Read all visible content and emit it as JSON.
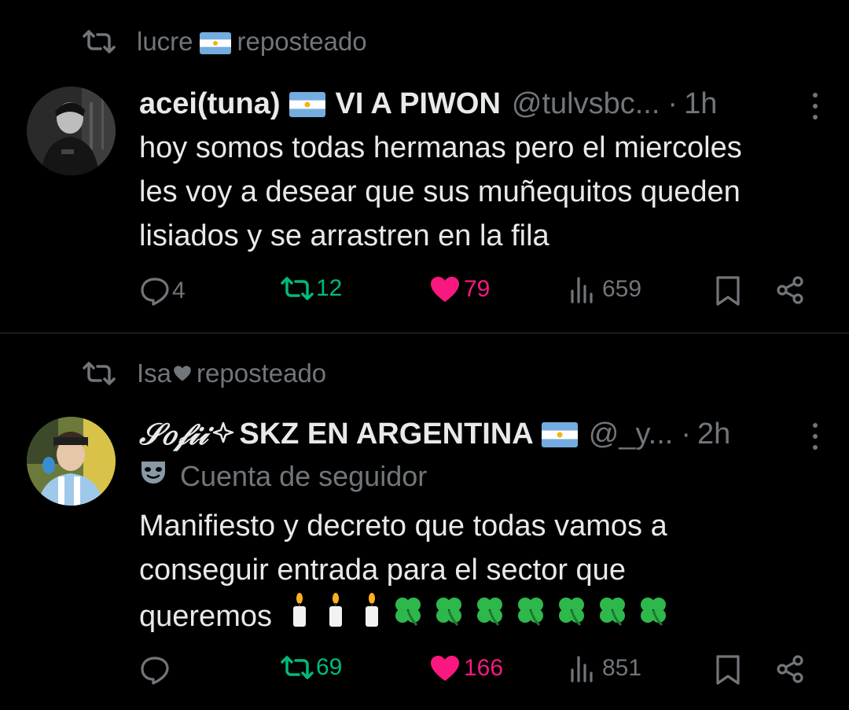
{
  "tweets": [
    {
      "repost_by": "lucre",
      "repost_label": "reposteado",
      "display_name": "acei(tuna)",
      "display_name_suffix": "VI A PIWON",
      "handle": "@tulvsbc...",
      "dot": "·",
      "time": "1h",
      "text_lines": [
        "hoy somos todas hermanas pero el miercoles",
        "les voy a desear que sus muñequitos queden",
        "lisiados y se arrastren en la fila"
      ],
      "stats": {
        "replies": "4",
        "reposts": "12",
        "likes": "79",
        "views": "659"
      }
    },
    {
      "repost_by": "Isa",
      "repost_label": "reposteado",
      "display_name": "𝒮𝑜𝒻𝒾𝒾",
      "display_name_suffix": "SKZ EN ARGENTINA",
      "handle": "@_y...",
      "dot": "·",
      "time": "2h",
      "sub_label": "Cuenta de seguidor",
      "text_lines": [
        "Manifiesto y decreto que todas vamos a",
        "conseguir entrada para el sector que",
        "queremos"
      ],
      "stats": {
        "replies": "",
        "reposts": "69",
        "likes": "166",
        "views": "851"
      }
    }
  ],
  "colors": {
    "muted": "#71767b",
    "repost": "#00ba7c",
    "like": "#f91880",
    "text": "#e7e9ea",
    "bg": "#000000"
  },
  "icons": [
    "repost-icon",
    "flag-argentina-icon",
    "more-icon",
    "reply-icon",
    "like-icon",
    "views-icon",
    "bookmark-icon",
    "share-icon",
    "mask-icon",
    "candle-icon",
    "clover-icon",
    "sparkle-icon",
    "heart-icon"
  ]
}
